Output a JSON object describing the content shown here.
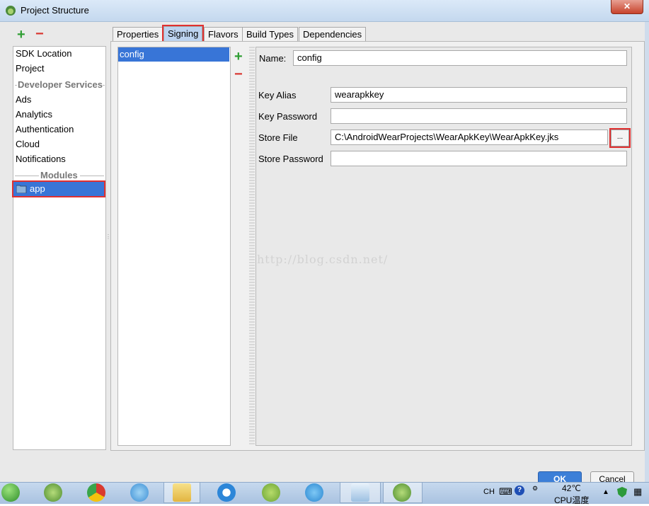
{
  "window": {
    "title": "Project Structure",
    "close_glyph": "✕"
  },
  "left": {
    "add_glyph": "+",
    "remove_glyph": "−",
    "items": [
      {
        "label": "SDK Location"
      },
      {
        "label": "Project"
      }
    ],
    "developer_services_header": "Developer Services",
    "services": [
      {
        "label": "Ads"
      },
      {
        "label": "Analytics"
      },
      {
        "label": "Authentication"
      },
      {
        "label": "Cloud"
      },
      {
        "label": "Notifications"
      }
    ],
    "modules_header": "Modules",
    "module": "app"
  },
  "tabs": [
    {
      "label": "Properties"
    },
    {
      "label": "Signing"
    },
    {
      "label": "Flavors"
    },
    {
      "label": "Build Types"
    },
    {
      "label": "Dependencies"
    }
  ],
  "signing": {
    "configs": [
      "config"
    ],
    "add_glyph": "+",
    "remove_glyph": "−",
    "name_label": "Name:",
    "name_value": "config",
    "key_alias_label": "Key Alias",
    "key_alias_value": "wearapkkey",
    "key_password_label": "Key Password",
    "key_password_value": "",
    "store_file_label": "Store File",
    "store_file_value": "C:\\AndroidWearProjects\\WearApkKey\\WearApkKey.jks",
    "browse_label": "...",
    "store_password_label": "Store Password",
    "store_password_value": ""
  },
  "watermark": "http://blog.csdn.net/",
  "buttons": {
    "ok": "OK",
    "cancel": "Cancel"
  },
  "taskbar": {
    "lang": "CH",
    "temp": "42℃",
    "temp_label": "CPU温度"
  },
  "colors": {
    "selection": "#3875d7",
    "highlight_box": "#e03030",
    "add": "#2f9e33",
    "remove": "#d9362f"
  }
}
